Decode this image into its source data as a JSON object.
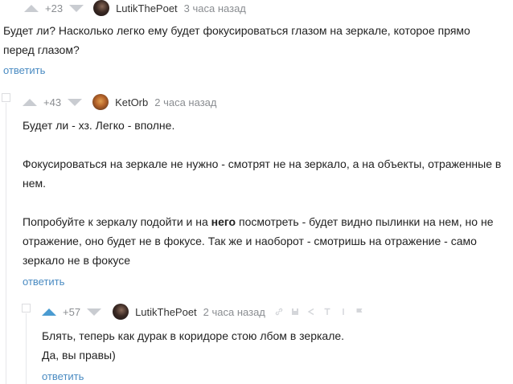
{
  "comments": [
    {
      "rating": "+23",
      "author": "LutikThePoet",
      "time": "3 часа назад",
      "paragraphs": [
        "Будет ли? Насколько легко ему будет фокусироваться глазом на зеркале, которое прямо перед глазом?"
      ],
      "reply_label": "ответить"
    },
    {
      "rating": "+43",
      "author": "KetOrb",
      "time": "2 часа назад",
      "paragraphs": [
        "Будет ли - хз. Легко - вполне.",
        "Фокусироваться на зеркале не нужно - смотрят не на зеркало, а на объекты, отраженные в нем."
      ],
      "paragraph3": {
        "before": "Попробуйте к зеркалу подойти и на ",
        "bold": "него",
        "after": " посмотреть - будет видно пылинки на нем, но не отражение, оно будет не в фокусе. Так же и наоборот - смотришь на отражение - само зеркало не в фокусе"
      },
      "reply_label": "ответить"
    },
    {
      "rating": "+57",
      "author": "LutikThePoet",
      "time": "2 часа назад",
      "paragraphs": [
        "Блять, теперь как дурак в коридоре стою лбом в зеркале.",
        "Да, вы правы)"
      ],
      "reply_label": "ответить",
      "tool_icons": [
        "link-icon",
        "save-icon",
        "share-icon",
        "text-icon",
        "more-icon",
        "flag-icon"
      ]
    }
  ],
  "colors": {
    "accent": "#4a8bc2",
    "vote_active": "#4a9bd1",
    "muted": "#8a8d91"
  }
}
